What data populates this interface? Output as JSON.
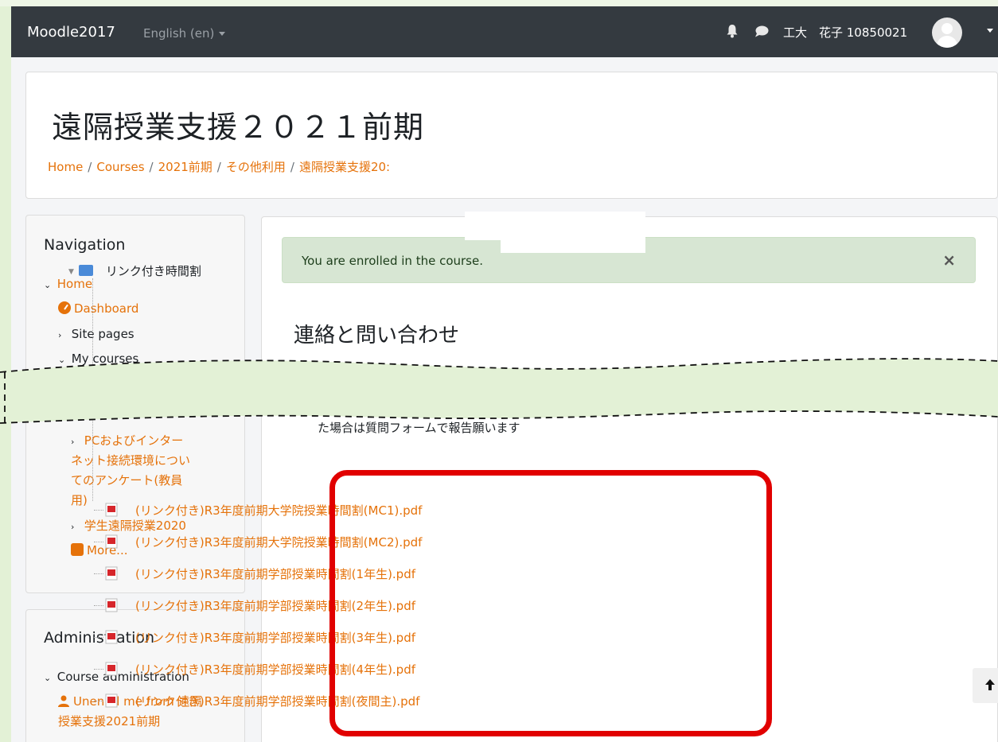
{
  "navbar": {
    "site_name": "Moodle2017",
    "language": "English (en)",
    "username": "工大　花子 10850021",
    "icons": [
      "bell-icon",
      "chat-icon",
      "avatar",
      "chevron-down-icon"
    ]
  },
  "header": {
    "title": "遠隔授業支援２０２１前期",
    "breadcrumb": [
      "Home",
      "Courses",
      "2021前期",
      "その他利用",
      "遠隔授業支援20:"
    ]
  },
  "navigation": {
    "title": "Navigation",
    "home": "Home",
    "dashboard": "Dashboard",
    "site_pages": "Site pages",
    "my_courses": "My courses",
    "course_pc_line1": "PCおよびインター",
    "course_pc_line2": "ネット接続環境につい",
    "course_pc_line3": "てのアンケート(教員",
    "course_pc_line4": "用)",
    "course_student": "学生遠隔授業2020",
    "more": "More..."
  },
  "administration": {
    "title": "Administration",
    "course_admin": "Course administration",
    "unenrol_line1": "Unenrol me from 遠隔",
    "unenrol_line2": "授業支援2021前期"
  },
  "main": {
    "alert": "You are enrolled in the course.",
    "alert_close": "×",
    "section_title": "連絡と問い合わせ",
    "section_text": "た場合は質問フォームで報告願います",
    "folder_name": "リンク付き時間割",
    "files": [
      "(リンク付き)R3年度前期大学院授業時間割(MC1).pdf",
      "(リンク付き)R3年度前期大学院授業時間割(MC2).pdf",
      "(リンク付き)R3年度前期学部授業時間割(1年生).pdf",
      "(リンク付き)R3年度前期学部授業時間割(2年生).pdf",
      "(リンク付き)R3年度前期学部授業時間割(3年生).pdf",
      "(リンク付き)R3年度前期学部授業時間割(4年生).pdf",
      "(リンク付き)R3年度前期学部授業時間割(夜間主).pdf"
    ]
  },
  "colors": {
    "navbar": "#343a40",
    "link": "#e5720a",
    "alert_bg": "#d7e6d3",
    "highlight": "#e10000",
    "omission_band": "#e3f1d6"
  }
}
